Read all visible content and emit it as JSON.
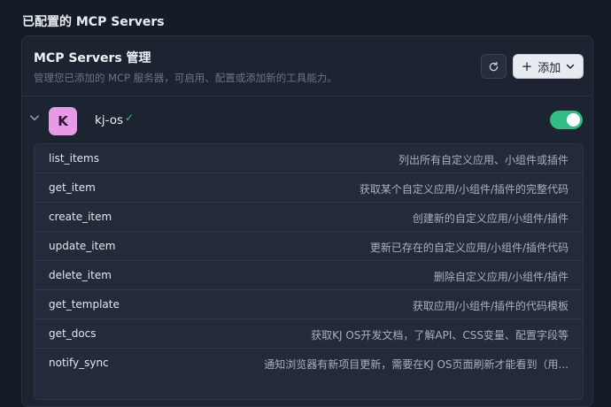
{
  "section": {
    "title": "已配置的 MCP Servers"
  },
  "panel": {
    "title": "MCP Servers 管理",
    "subtitle": "管理您已添加的 MCP 服务器，可启用、配置或添加新的工具能力。",
    "refresh_icon": "refresh-icon",
    "add_label": "添加",
    "add_icon": "plus-icon",
    "dropdown_icon": "chevron-down-icon"
  },
  "server": {
    "icon_letter": "K",
    "icon_color": "#e79ae6",
    "name": "kj-os",
    "status_icon": "check-icon",
    "enabled": true,
    "accent": "#2fbf86"
  },
  "tools": [
    {
      "name": "list_items",
      "description": "列出所有自定义应用、小组件或插件"
    },
    {
      "name": "get_item",
      "description": "获取某个自定义应用/小组件/插件的完整代码"
    },
    {
      "name": "create_item",
      "description": "创建新的自定义应用/小组件/插件"
    },
    {
      "name": "update_item",
      "description": "更新已存在的自定义应用/小组件/插件代码"
    },
    {
      "name": "delete_item",
      "description": "删除自定义应用/小组件/插件"
    },
    {
      "name": "get_template",
      "description": "获取应用/小组件/插件的代码模板"
    },
    {
      "name": "get_docs",
      "description": "获取KJ OS开发文档，了解API、CSS变量、配置字段等"
    },
    {
      "name": "notify_sync",
      "description": "通知浏览器有新项目更新，需要在KJ OS页面刷新才能看到（用..."
    }
  ]
}
